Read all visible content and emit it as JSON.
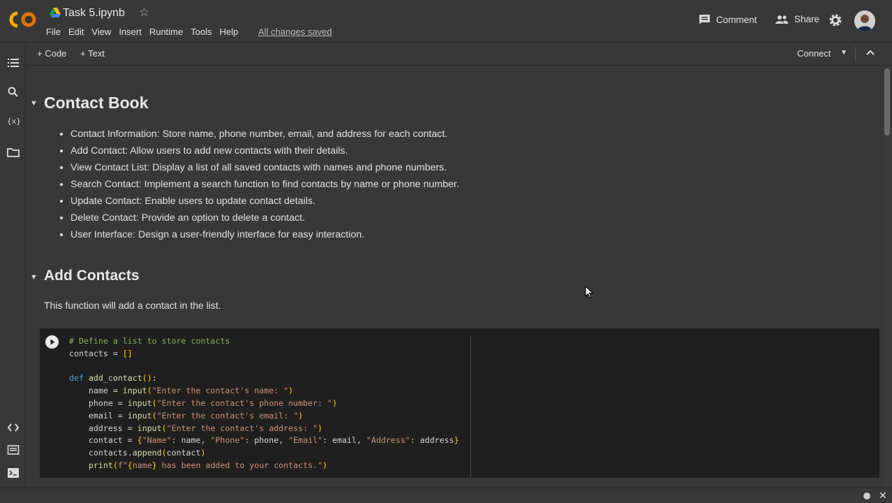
{
  "header": {
    "notebook_title": "Task 5.ipynb",
    "menu": [
      "File",
      "Edit",
      "View",
      "Insert",
      "Runtime",
      "Tools",
      "Help"
    ],
    "saved_status": "All changes saved",
    "comment_label": "Comment",
    "share_label": "Share"
  },
  "toolbar": {
    "add_code_label": "+ Code",
    "add_text_label": "+ Text",
    "connect_label": "Connect"
  },
  "sidebar": {
    "icons": [
      "table-of-contents-icon",
      "search-icon",
      "variables-icon",
      "files-icon",
      "code-snippets-icon",
      "command-palette-icon",
      "terminal-icon"
    ],
    "variables_glyph": "{x}"
  },
  "sections": {
    "contact_book": {
      "title": "Contact Book",
      "bullets": [
        "Contact Information: Store name, phone number, email, and address for each contact.",
        "Add Contact: Allow users to add new contacts with their details.",
        "View Contact List: Display a list of all saved contacts with names and phone numbers.",
        "Search Contact: Implement a search function to find contacts by name or phone number.",
        "Update Contact: Enable users to update contact details.",
        "Delete Contact: Provide an option to delete a contact.",
        "User Interface: Design a user-friendly interface for easy interaction."
      ]
    },
    "add_contacts": {
      "title": "Add Contacts",
      "description": "This function will add a contact in the list."
    }
  },
  "code_cell": {
    "lines": [
      "# Define a list to store contacts",
      "contacts = []",
      "",
      "def add_contact():",
      "    name = input(\"Enter the contact's name: \")",
      "    phone = input(\"Enter the contact's phone number: \")",
      "    email = input(\"Enter the contact's email: \")",
      "    address = input(\"Enter the contact's address: \")",
      "    contact = {\"Name\": name, \"Phone\": phone, \"Email\": email, \"Address\": address}",
      "    contacts.append(contact)",
      "    print(f\"{name} has been added to your contacts.\")"
    ]
  },
  "colors": {
    "background": "#383838",
    "code_background": "#1f1f1f",
    "logo_orange": "#f9ab00",
    "logo_yellow": "#e37400"
  }
}
